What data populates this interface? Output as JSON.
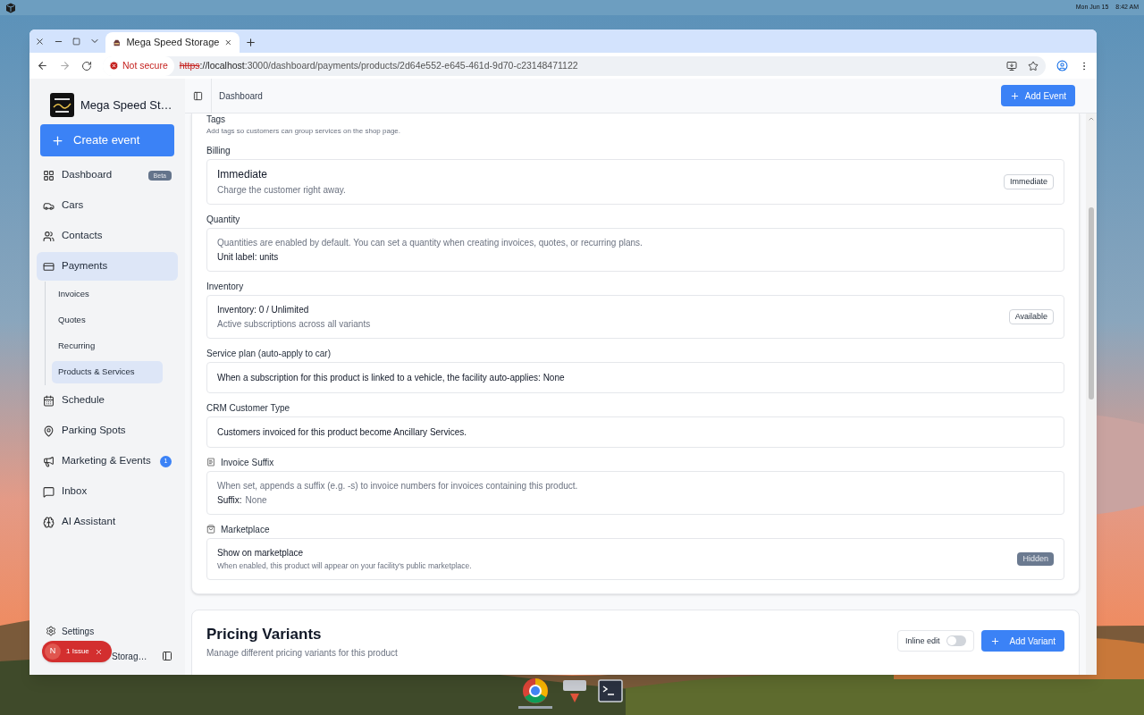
{
  "desktop": {
    "top_bar": {
      "date": "Mon Jun 15",
      "time": "8:42 AM"
    }
  },
  "browser": {
    "tab": {
      "title": "Mega Speed Storage"
    },
    "address": {
      "security": "Not secure",
      "scheme": "https",
      "host": "://localhost",
      "path": ":3000/dashboard/payments/products/2d64e552-e645-461d-9d70-c23148471122"
    }
  },
  "sidebar": {
    "brand": "Mega Speed St…",
    "create_button": "Create event",
    "items": [
      {
        "label": "Dashboard",
        "selected": false,
        "badge": {
          "kind": "tag",
          "text": "Beta"
        }
      },
      {
        "label": "Cars",
        "selected": false
      },
      {
        "label": "Contacts",
        "selected": false
      },
      {
        "label": "Payments",
        "selected": true,
        "children": [
          {
            "label": "Invoices",
            "selected": false
          },
          {
            "label": "Quotes",
            "selected": false
          },
          {
            "label": "Recurring",
            "selected": false
          },
          {
            "label": "Products & Services",
            "selected": true
          }
        ]
      },
      {
        "label": "Schedule",
        "selected": false
      },
      {
        "label": "Parking Spots",
        "selected": false
      },
      {
        "label": "Marketing & Events",
        "selected": false,
        "badge": {
          "kind": "count",
          "text": "1"
        }
      },
      {
        "label": "Inbox",
        "selected": false
      },
      {
        "label": "AI Assistant",
        "selected": false
      }
    ],
    "settings": "Settings",
    "account": "Storag…",
    "issue": {
      "avatar": "N",
      "text": "1 Issue"
    }
  },
  "header": {
    "breadcrumb": "Dashboard",
    "button": "Add Event"
  },
  "sections": [
    {
      "label": "Tags",
      "description": "Add tags so customers can group services on the shop page."
    },
    {
      "label": "Billing",
      "box": {
        "lines": [
          {
            "kind": "title",
            "text": "Immediate"
          },
          {
            "kind": "muted",
            "text": "Charge the customer right away."
          }
        ],
        "badge": {
          "kind": "outline",
          "text": "Immediate"
        }
      }
    },
    {
      "label": "Quantity",
      "box": {
        "lines": [
          {
            "kind": "muted",
            "text": "Quantities are enabled by default. You can set a quantity when creating invoices, quotes, or recurring plans."
          },
          {
            "kind": "strong",
            "text": "Unit label: units"
          }
        ]
      }
    },
    {
      "label": "Inventory",
      "box": {
        "lines": [
          {
            "kind": "strong",
            "text": "Inventory: 0 / Unlimited"
          },
          {
            "kind": "muted",
            "text": "Active subscriptions across all variants"
          }
        ],
        "badge": {
          "kind": "outline",
          "text": "Available"
        }
      }
    },
    {
      "label": "Service plan (auto-apply to car)",
      "box": {
        "lines": [
          {
            "kind": "strong",
            "text": "When a subscription for this product is linked to a vehicle, the facility auto-applies: None"
          }
        ]
      }
    },
    {
      "label": "CRM Customer Type",
      "box": {
        "lines": [
          {
            "kind": "strong",
            "text": "Customers invoiced for this product become Ancillary Services."
          }
        ]
      }
    },
    {
      "label": "Invoice Suffix",
      "box": {
        "lines": [
          {
            "kind": "muted",
            "text": "When set, appends a suffix (e.g. -s) to invoice numbers for invoices containing this product."
          },
          {
            "kind": "pair",
            "label": "Suffix:",
            "text": "None"
          }
        ]
      }
    },
    {
      "label": "Marketplace",
      "box": {
        "lines": [
          {
            "kind": "strong",
            "text": "Show on marketplace"
          },
          {
            "kind": "small",
            "text": "When enabled, this product will appear on your facility's public marketplace."
          }
        ],
        "badge": {
          "kind": "filled",
          "text": "Hidden"
        }
      }
    }
  ],
  "pricing": {
    "title": "Pricing Variants",
    "subtitle": "Manage different pricing variants for this product",
    "toggle": {
      "label": "Inline edit",
      "on": false
    },
    "button": "Add Variant"
  }
}
